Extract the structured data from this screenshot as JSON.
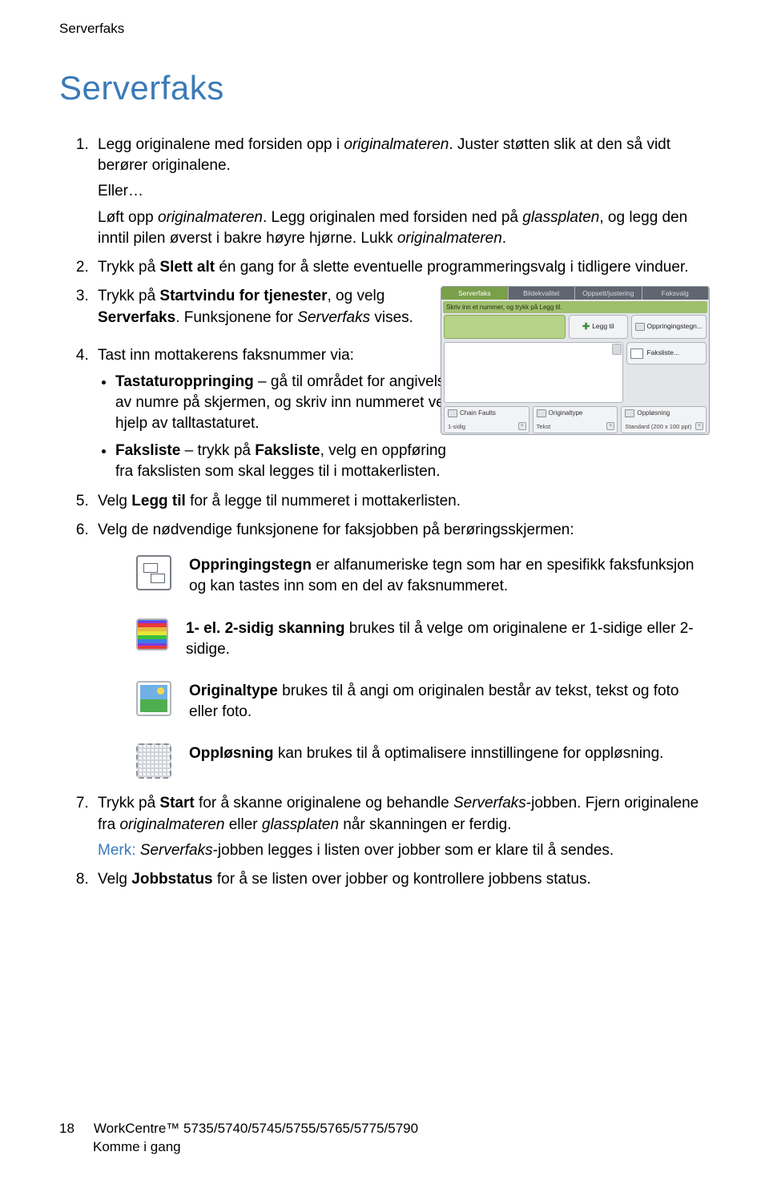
{
  "header": {
    "running": "Serverfaks"
  },
  "title": "Serverfaks",
  "steps": {
    "s1": {
      "p1a": "Legg originalene med forsiden opp i ",
      "p1b": "originalmateren",
      "p1c": ". Juster støtten slik at den så vidt berører originalene.",
      "eller": "Eller…",
      "p2a": "Løft opp ",
      "p2b": "originalmateren",
      "p2c": ". Legg originalen med forsiden ned på ",
      "p2d": "glassplaten",
      "p2e": ", og legg den inntil pilen øverst i bakre høyre hjørne. Lukk ",
      "p2f": "originalmateren",
      "p2g": "."
    },
    "s2a": "Trykk på ",
    "s2b": "Slett alt",
    "s2c": " én gang for å slette eventuelle programmeringsvalg i tidligere vinduer.",
    "s3a": "Trykk på ",
    "s3b": "Startvindu for tjenester",
    "s3c": ", og velg ",
    "s3d": "Serverfaks",
    "s3e": ". Funksjonene for ",
    "s3f": "Serverfaks",
    "s3g": " vises.",
    "s4_lead": "Tast inn mottakerens faksnummer via:",
    "s4_b1a": "Tastaturoppringing",
    "s4_b1b": " – gå til området for angivelse av numre på skjermen, og skriv inn nummeret ved hjelp av talltastaturet.",
    "s4_b2a": "Faksliste",
    "s4_b2b": " – trykk på ",
    "s4_b2c": "Faksliste",
    "s4_b2d": ", velg en oppføring fra fakslisten som skal legges til i mottakerlisten.",
    "s5a": "Velg ",
    "s5b": "Legg til",
    "s5c": " for å legge til nummeret i mottakerlisten.",
    "s6": "Velg de nødvendige funksjonene for faksjobben på berøringsskjermen:",
    "s7a": "Trykk på ",
    "s7b": "Start",
    "s7c": " for å skanne originalene og behandle ",
    "s7d": "Serverfaks",
    "s7e": "-jobben. Fjern originalene fra ",
    "s7f": "originalmateren",
    "s7g": " eller ",
    "s7h": "glassplaten",
    "s7i": " når skanningen er ferdig.",
    "s7_note_lbl": "Merk:",
    "s7_note_a": " ",
    "s7_note_b": "Serverfaks",
    "s7_note_c": "-jobben legges i listen over jobber som er klare til å sendes.",
    "s8a": "Velg ",
    "s8b": "Jobbstatus",
    "s8c": " for å se listen over jobber og kontrollere jobbens status."
  },
  "features": {
    "oppr_b": "Oppringingstegn",
    "oppr_t": " er alfanumeriske tegn som har en spesifikk faksfunksjon og kan tastes inn som en del av faksnummeret.",
    "sidig_b": "1- el. 2-sidig skanning",
    "sidig_t": " brukes til å velge om originalene er 1-sidige eller 2-sidige.",
    "orig_b": "Originaltype",
    "orig_t": " brukes til å angi om originalen består av tekst, tekst og foto eller foto.",
    "oppl_b": "Oppløsning",
    "oppl_t": " kan brukes til å optimalisere innstillingene for oppløsning."
  },
  "panel": {
    "tabs": [
      "Serverfaks",
      "Bildekvalitet",
      "Oppsett/justering",
      "Faksvalg"
    ],
    "instr": "Skriv inn et nummer, og trykk på Legg til.",
    "leggtil": "Legg til",
    "oppringing": "Oppringingstegn...",
    "faksliste": "Faksliste...",
    "opts": [
      {
        "label": "Chain Faults",
        "value": "1-sidig"
      },
      {
        "label": "Originaltype",
        "value": "Tekst"
      },
      {
        "label": "Oppløsning",
        "value": "Standard (200 x 100 ppt)"
      }
    ]
  },
  "footer": {
    "page": "18",
    "line1": "WorkCentre™ 5735/5740/5745/5755/5765/5775/5790",
    "line2": "Komme i gang"
  }
}
